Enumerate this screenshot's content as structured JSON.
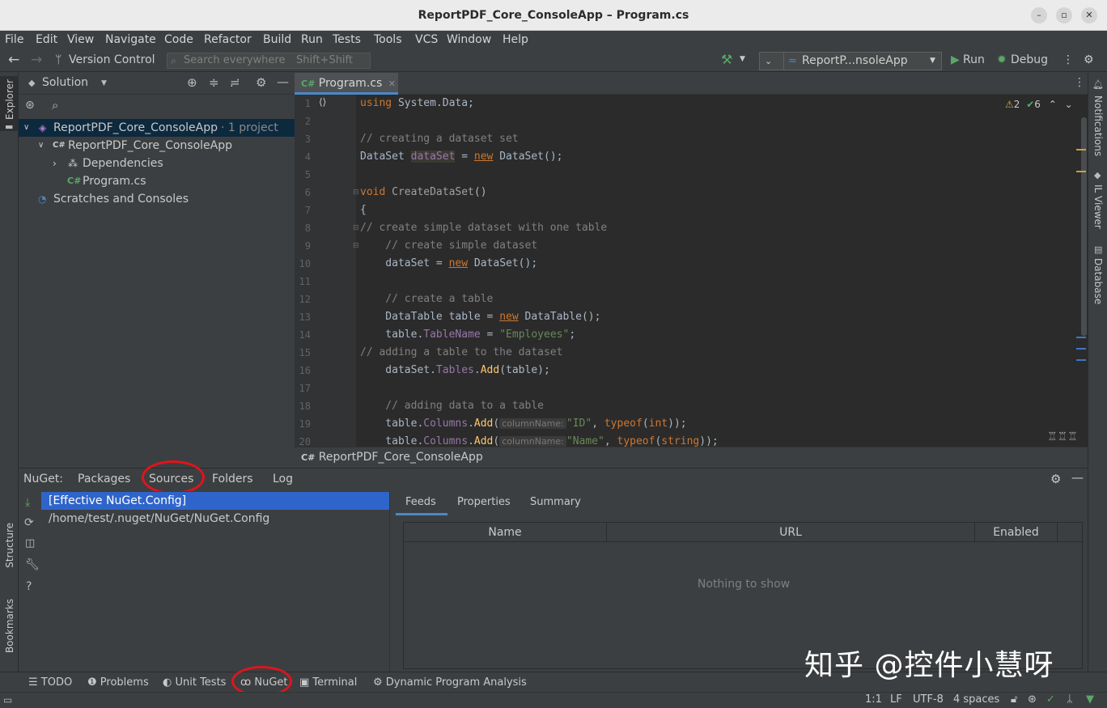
{
  "window": {
    "title": "ReportPDF_Core_ConsoleApp – Program.cs"
  },
  "menu": [
    "File",
    "Edit",
    "View",
    "Navigate",
    "Code",
    "Refactor",
    "Build",
    "Run",
    "Tests",
    "Tools",
    "VCS",
    "Window",
    "Help"
  ],
  "toolbar": {
    "version_control": "Version Control",
    "search_placeholder": "Search everywhere",
    "search_shortcut": "Shift+Shift",
    "run_config": "ReportP...nsoleApp",
    "run_label": "Run",
    "debug_label": "Debug"
  },
  "left_stripe": {
    "explorer": "Explorer",
    "structure": "Structure",
    "bookmarks": "Bookmarks"
  },
  "right_stripe": {
    "notifications": "Notifications",
    "il_viewer": "IL Viewer",
    "database": "Database"
  },
  "explorer": {
    "title": "Solution",
    "tree": {
      "solution": "ReportPDF_Core_ConsoleApp",
      "solution_meta": "· 1 project",
      "project": "ReportPDF_Core_ConsoleApp",
      "dependencies": "Dependencies",
      "file": "Program.cs",
      "scratches": "Scratches and Consoles"
    }
  },
  "editor": {
    "tab": "Program.cs",
    "warnings": "2",
    "checks": "6",
    "breadcrumb": "ReportPDF_Core_ConsoleApp",
    "lines": [
      "1",
      "2",
      "3",
      "4",
      "5",
      "6",
      "7",
      "8",
      "9",
      "10",
      "11",
      "12",
      "13",
      "14",
      "15",
      "16",
      "17",
      "18",
      "19",
      "20"
    ],
    "code": {
      "l1_kw": "using",
      "l1_rest": " System.Data;",
      "l3": "// creating a dataset set",
      "l4_a": "DataSet ",
      "l4_var": "dataSet",
      "l4_b": " = ",
      "l4_new": "new",
      "l4_c": " DataSet();",
      "l6_kw": "void",
      "l6_fn": " CreateDataSet",
      "l6_rest": "()",
      "l7": "{",
      "l8": "// create simple dataset with one table",
      "l9": "    // create simple dataset",
      "l10_a": "    dataSet = ",
      "l10_new": "new",
      "l10_b": " DataSet();",
      "l12": "    // create a table",
      "l13_a": "    DataTable table = ",
      "l13_new": "new",
      "l13_b": " DataTable();",
      "l14_a": "    table.",
      "l14_prop": "TableName",
      "l14_b": " = ",
      "l14_str": "\"Employees\"",
      "l14_c": ";",
      "l15": "// adding a table to the dataset",
      "l16_a": "    dataSet.",
      "l16_prop": "Tables",
      "l16_b": ".",
      "l16_fn": "Add",
      "l16_c": "(table);",
      "l18": "    // adding data to a table",
      "l19_a": "    table.",
      "l19_prop": "Columns",
      "l19_b": ".",
      "l19_fn": "Add",
      "l19_c": "(",
      "l19_hint": "columnName:",
      "l19_str": "\"ID\"",
      "l19_d": ", ",
      "l19_kw": "typeof",
      "l19_e": "(",
      "l19_kw2": "int",
      "l19_f": "));",
      "l20_a": "    table.",
      "l20_prop": "Columns",
      "l20_b": ".",
      "l20_fn": "Add",
      "l20_c": "(",
      "l20_hint": "columnName:",
      "l20_str": "\"Name\"",
      "l20_d": ", ",
      "l20_kw": "typeof",
      "l20_e": "(",
      "l20_kw2": "string",
      "l20_f": "));"
    }
  },
  "nuget": {
    "label": "NuGet:",
    "tabs": [
      "Packages",
      "Sources",
      "Folders",
      "Log"
    ],
    "sources": [
      "[Effective NuGet.Config]",
      "/home/test/.nuget/NuGet/NuGet.Config"
    ],
    "detail_tabs": [
      "Feeds",
      "Properties",
      "Summary"
    ],
    "columns": [
      "Name",
      "URL",
      "Enabled"
    ],
    "empty": "Nothing to show"
  },
  "tool_windows": [
    "TODO",
    "Problems",
    "Unit Tests",
    "NuGet",
    "Terminal",
    "Dynamic Program Analysis"
  ],
  "status": {
    "position": "1:1",
    "line_ending": "LF",
    "encoding": "UTF-8",
    "indent": "4 spaces"
  },
  "watermark": "知乎 @控件小慧呀",
  "colors": {
    "accent": "#4a88c7",
    "selection": "#2f65ca",
    "highlight_ring": "#e0141c"
  }
}
